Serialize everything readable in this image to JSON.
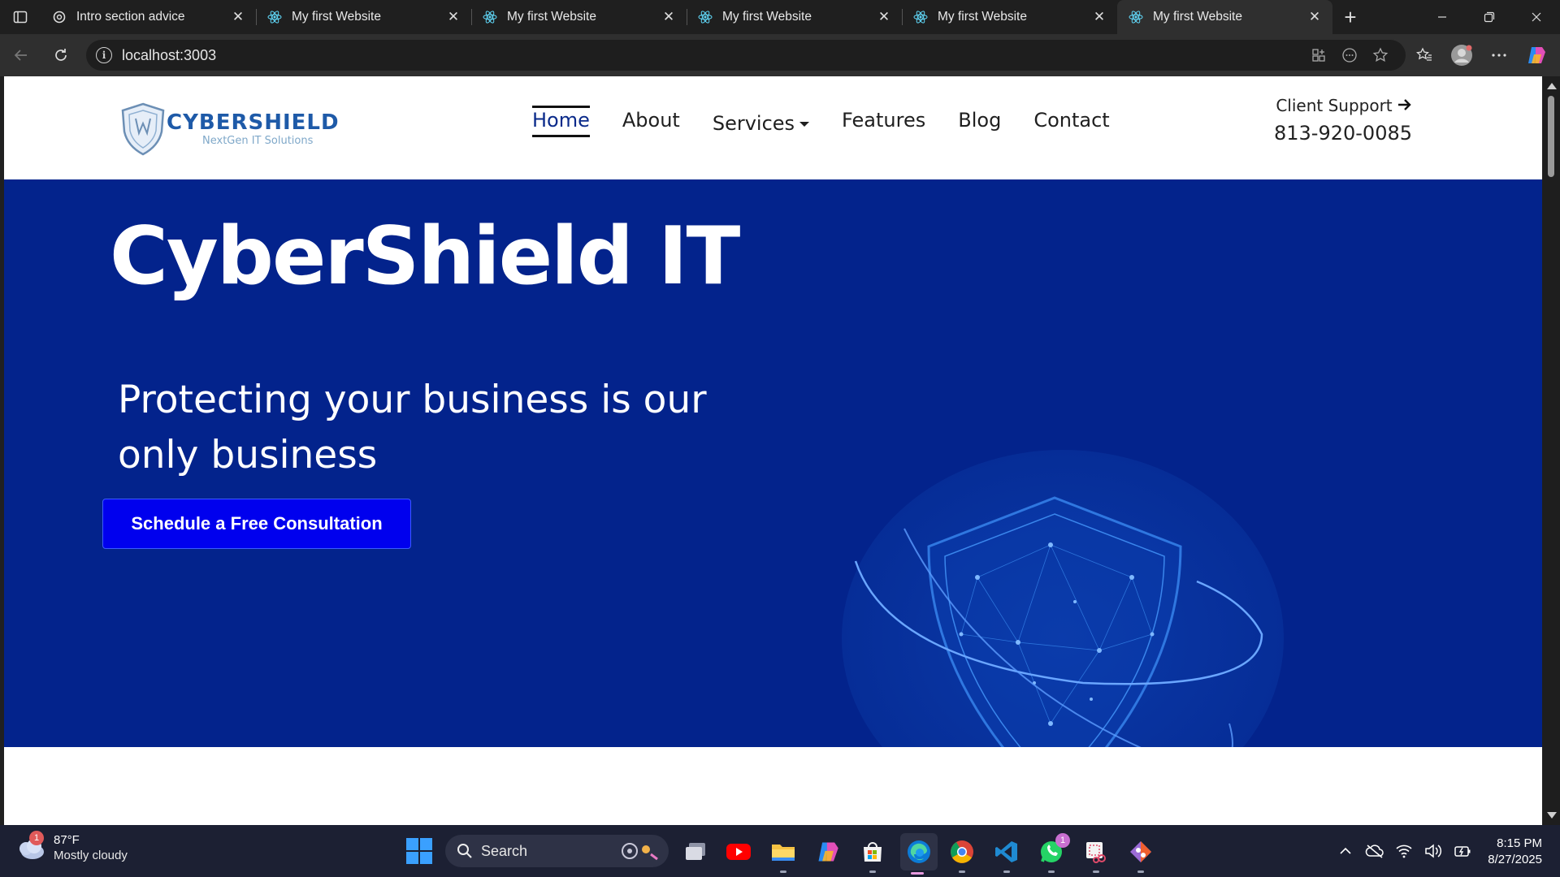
{
  "browser": {
    "tabs": [
      {
        "title": "Intro section advice",
        "icon": "openai-icon",
        "active": false
      },
      {
        "title": "My first Website",
        "icon": "react-icon",
        "active": false
      },
      {
        "title": "My first Website",
        "icon": "react-icon",
        "active": false
      },
      {
        "title": "My first Website",
        "icon": "react-icon",
        "active": false
      },
      {
        "title": "My first Website",
        "icon": "react-icon",
        "active": false
      },
      {
        "title": "My first Website",
        "icon": "react-icon",
        "active": true
      }
    ],
    "url": "localhost:3003"
  },
  "site": {
    "logo": {
      "wordmark": "CYBERSHIELD",
      "tagline": "NextGen IT Solutions"
    },
    "nav": {
      "home": "Home",
      "about": "About",
      "services": "Services",
      "features": "Features",
      "blog": "Blog",
      "contact": "Contact"
    },
    "support": {
      "label": "Client Support",
      "phone": "813-920-0085"
    },
    "hero": {
      "title": "CyberShield IT",
      "subtitle": "Protecting your business is our only business",
      "cta": "Schedule a Free Consultation"
    }
  },
  "taskbar": {
    "weather": {
      "temp": "87°F",
      "desc": "Mostly cloudy",
      "badge": "1"
    },
    "search_placeholder": "Search",
    "whatsapp_badge": "1",
    "time": "8:15 PM",
    "date": "8/27/2025"
  },
  "colors": {
    "hero_bg": "#03238c",
    "cta_bg": "#0000ee",
    "nav_active": "#0a2a8a",
    "logo_blue": "#1e5aa8"
  }
}
